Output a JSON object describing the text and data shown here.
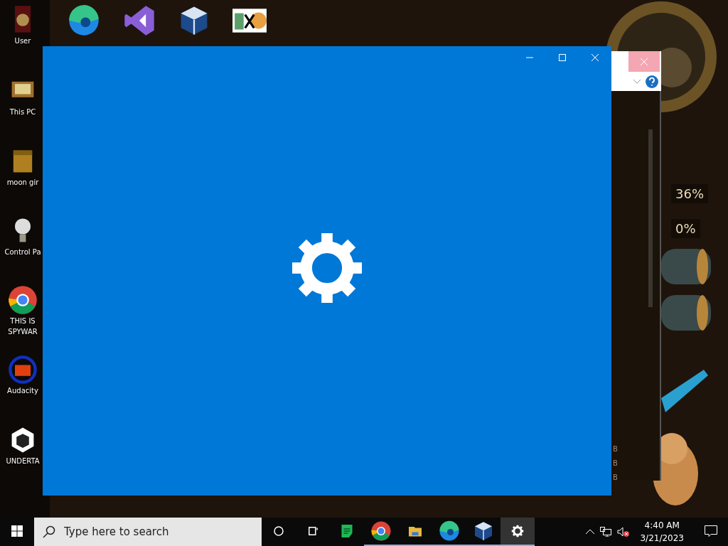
{
  "desktop_icons": [
    {
      "kind": "user",
      "label": "User"
    },
    {
      "kind": "pc",
      "label": "This PC"
    },
    {
      "kind": "box",
      "label": "moon gir"
    },
    {
      "kind": "bulb",
      "label": "Control Pa"
    },
    {
      "kind": "chrome",
      "label": "THIS IS SPYWAR"
    },
    {
      "kind": "audacity",
      "label": "Audacity"
    },
    {
      "kind": "unity",
      "label": "UNDERTA"
    }
  ],
  "top_icons": [
    {
      "kind": "edge"
    },
    {
      "kind": "vs"
    },
    {
      "kind": "vbox"
    },
    {
      "kind": "hxd"
    }
  ],
  "background_window": {
    "fragments": [
      "B",
      "B",
      "B"
    ]
  },
  "gadgets": [
    {
      "reading": "36%"
    },
    {
      "reading": "0%"
    }
  ],
  "settings_window": {
    "loading": true
  },
  "taskbar": {
    "search": {
      "placeholder": "Type here to search"
    },
    "apps": [
      {
        "kind": "cortana",
        "running": false,
        "selected": false
      },
      {
        "kind": "taskview",
        "running": false,
        "selected": false
      },
      {
        "kind": "sheets",
        "running": false,
        "selected": false
      },
      {
        "kind": "chrome",
        "running": true,
        "selected": false
      },
      {
        "kind": "explorer",
        "running": true,
        "selected": false
      },
      {
        "kind": "edge",
        "running": true,
        "selected": false
      },
      {
        "kind": "vbox",
        "running": true,
        "selected": false
      },
      {
        "kind": "settings",
        "running": true,
        "selected": true
      }
    ],
    "time": "4:40 AM",
    "date": "3/21/2023"
  }
}
